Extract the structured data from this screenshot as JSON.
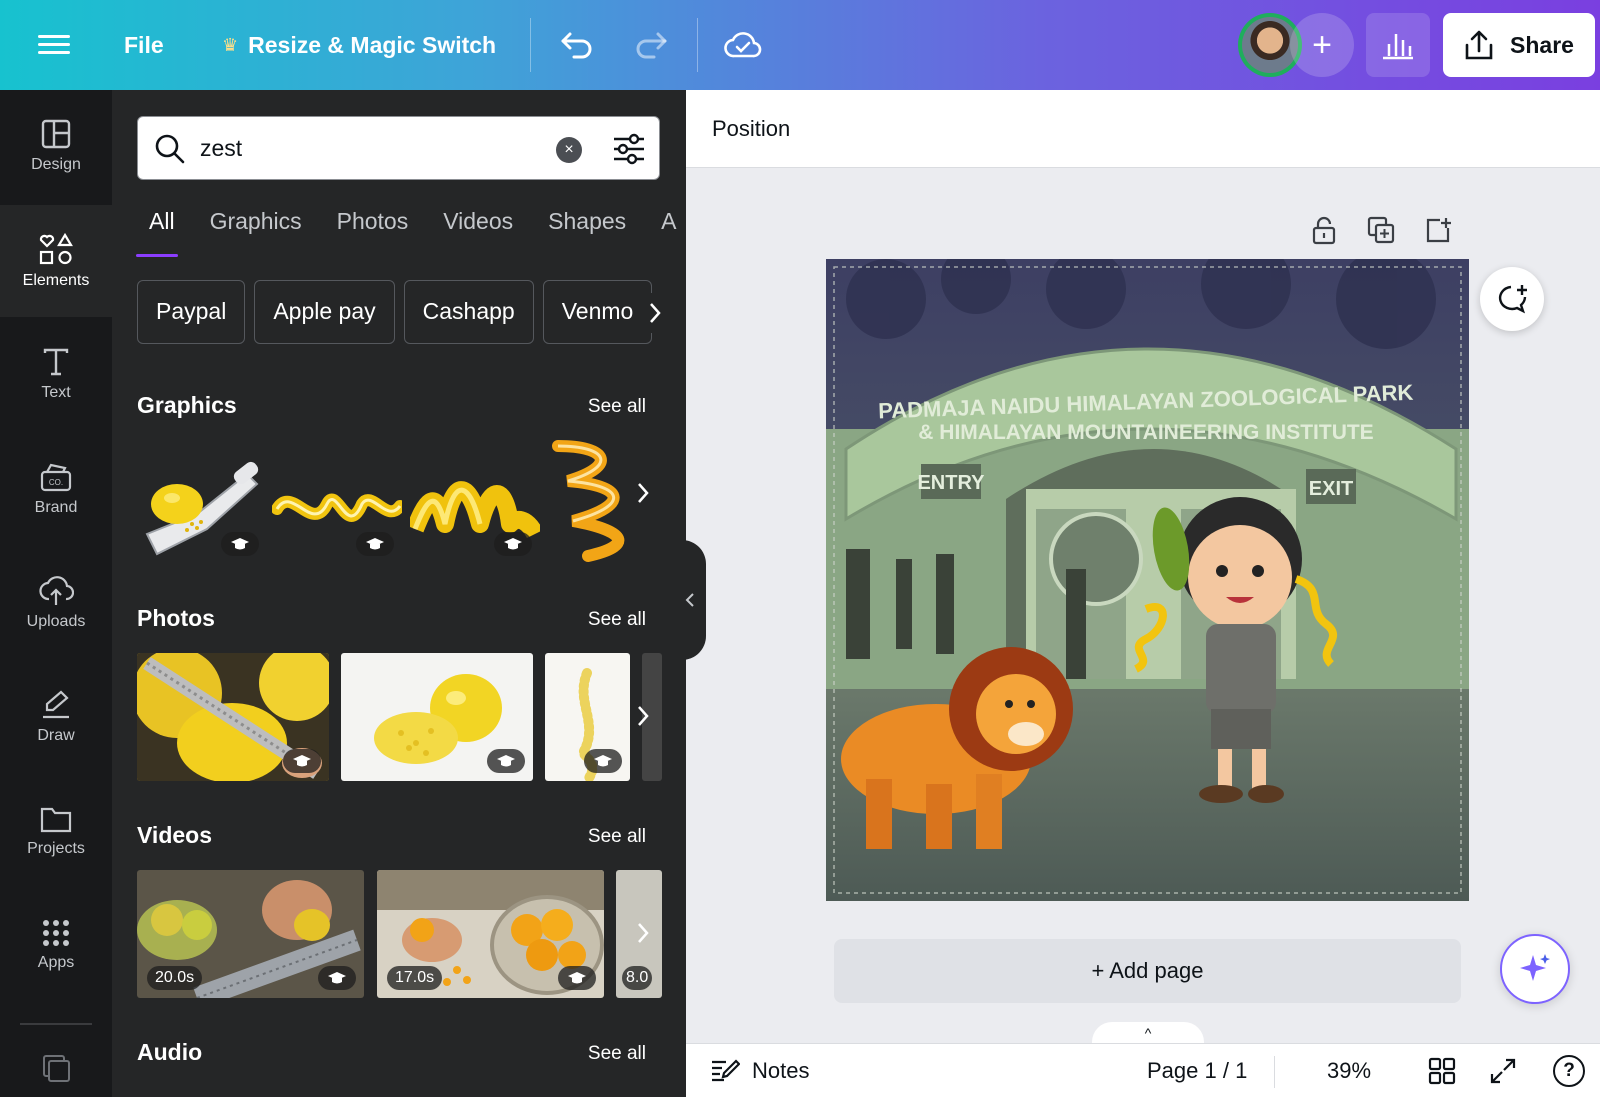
{
  "topbar": {
    "file_label": "File",
    "resize_label": "Resize & Magic Switch",
    "share_label": "Share",
    "invite_label": "+"
  },
  "rail": {
    "items": [
      {
        "label": "Design",
        "icon": "layout-icon"
      },
      {
        "label": "Elements",
        "icon": "shapes-icon",
        "active": true
      },
      {
        "label": "Text",
        "icon": "text-icon"
      },
      {
        "label": "Brand",
        "icon": "brand-icon"
      },
      {
        "label": "Uploads",
        "icon": "cloud-upload-icon"
      },
      {
        "label": "Draw",
        "icon": "draw-icon"
      },
      {
        "label": "Projects",
        "icon": "folder-icon"
      },
      {
        "label": "Apps",
        "icon": "apps-grid-icon"
      }
    ]
  },
  "panel": {
    "search": {
      "value": "zest",
      "clear": "×"
    },
    "tabs": [
      "All",
      "Graphics",
      "Photos",
      "Videos",
      "Shapes",
      "Au"
    ],
    "chips": [
      "Paypal",
      "Apple pay",
      "Cashapp",
      "Venmo"
    ],
    "sections": {
      "graphics": {
        "title": "Graphics",
        "see_all": "See all"
      },
      "photos": {
        "title": "Photos",
        "see_all": "See all"
      },
      "videos": {
        "title": "Videos",
        "see_all": "See all",
        "durations": [
          "20.0s",
          "17.0s",
          "8.0"
        ]
      },
      "audio": {
        "title": "Audio",
        "see_all": "See all"
      }
    }
  },
  "canvas": {
    "position_label": "Position",
    "add_page_label": "+ Add page",
    "design_sign_line1": "PADMAJA NAIDU HIMALAYAN ZOOLOGICAL PARK",
    "design_sign_line2": "& HIMALAYAN MOUNTAINEERING INSTITUTE",
    "entry_label": "ENTRY",
    "exit_label": "EXIT"
  },
  "footer": {
    "notes_label": "Notes",
    "page_label": "Page 1 / 1",
    "zoom_label": "39%",
    "help_label": "?",
    "tab_label": "^"
  },
  "colors": {
    "accent": "#8b3dff",
    "panel_bg": "#252627",
    "rail_bg": "#18191b"
  }
}
